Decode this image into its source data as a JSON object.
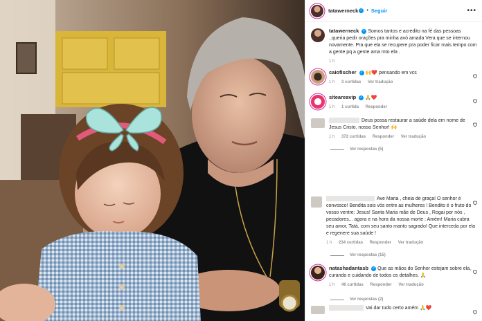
{
  "post": {
    "username": "tatawerneck",
    "follow_label": "Seguir",
    "more_label": "•••",
    "caption": "Somos tantos e acredito na fé das pessoas ..queria pedir orações pra minha avó amada Vera que se internou novamente. Pra que ela se recupere pra poder ficar mais tempo com a gente pq a gente ama mto ela .",
    "time": "1 h"
  },
  "comments": [
    {
      "user": "caiofischer",
      "verified": true,
      "text": "🙌❤️ pensando em vcs",
      "time": "1 h",
      "likes": "3 curtidas",
      "reply": "Ver tradução"
    },
    {
      "user": "siteareavip",
      "verified": true,
      "text": "🙏❤️",
      "time": "1 h",
      "likes": "1 curtida",
      "reply": "Responder"
    },
    {
      "user": "",
      "verified": false,
      "text": "Deus possa restaurar a saúde dela em nome de Jesus Cristo, nosso Senhor! 🙌",
      "time": "1 h",
      "likes": "372 curtidas",
      "reply": "Responder",
      "translate": "Ver tradução",
      "replies": "Ver respostas (5)"
    },
    {
      "user": "",
      "verified": false,
      "text": "Ave Maria , cheia de graça! O senhor é convosco! Bendita sois vós entre as mulheres ! Bendito é o fruto do vosso ventre: Jesus! Santa Maria mãe de Deus , Rogai por nós , pecadores... agora e na hora da nossa morte : Amém! Maria cubra seu amor, Tatá, com seu santo manto sagrado! Que interceda por ela e regenere sua saúde !",
      "time": "1 h",
      "likes": "234 curtidas",
      "reply": "Responder",
      "translate": "Ver tradução",
      "replies": "Ver respostas (15)"
    },
    {
      "user": "natashadantasb",
      "verified": true,
      "text": "Que as mãos do Senhor estejam sobre ela, curando e cuidando de todos os detalhes. 🙏",
      "time": "1 h",
      "likes": "46 curtidas",
      "reply": "Responder",
      "translate": "Ver tradução",
      "replies": "Ver respostas (2)"
    },
    {
      "user": "",
      "verified": false,
      "text": "Vai dar tudo certo amém 🙏❤️",
      "time": "",
      "likes": "",
      "reply": ""
    }
  ],
  "colors": {
    "blue": "#0095f6",
    "gray": "#8e8e8e",
    "text": "#262626",
    "border": "#efefef"
  }
}
